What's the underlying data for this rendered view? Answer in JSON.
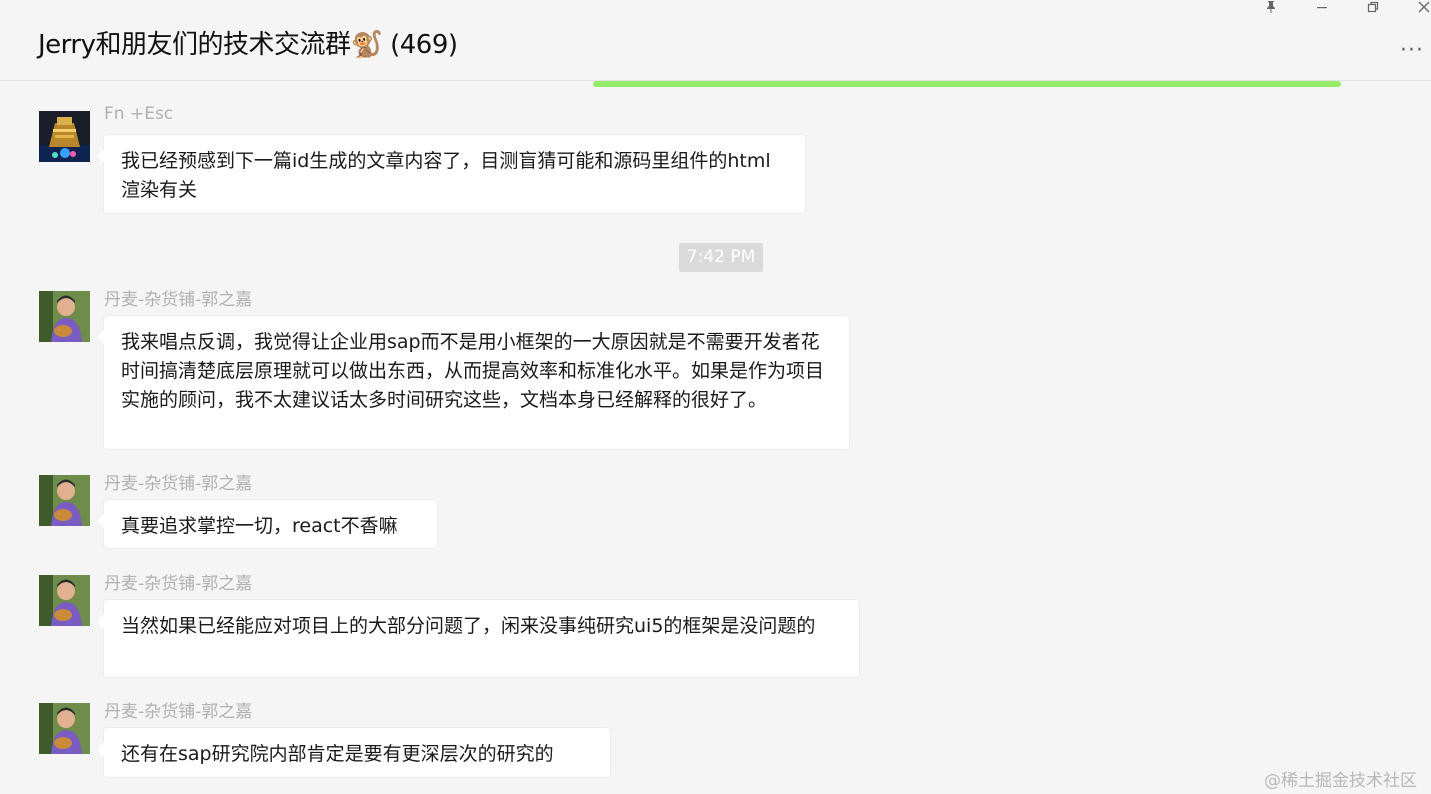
{
  "window": {
    "title": "Jerry和朋友们的技术交流群🐒 (469)",
    "pin_icon": "pin-icon",
    "minimize_icon": "minimize-icon",
    "restore_icon": "restore-icon",
    "close_icon": "close-icon",
    "more_label": "···"
  },
  "colors": {
    "background": "#f5f5f5",
    "bubble": "#ffffff",
    "accent_green": "#95ec69",
    "sender_gray": "#b0b0b0"
  },
  "loading_progress": 1.0,
  "timestamp": "7:42 PM",
  "messages": [
    {
      "sender": "Fn +Esc",
      "text": "我已经预感到下一篇id生成的文章内容了，目测盲猜可能和源码里组件的html渲染有关"
    },
    {
      "sender": "丹麦-杂货铺-郭之嘉",
      "text": "我来唱点反调，我觉得让企业用sap而不是用小框架的一大原因就是不需要开发者花时间搞清楚底层原理就可以做出东西，从而提高效率和标准化水平。如果是作为项目实施的顾问，我不太建议话太多时间研究这些，文档本身已经解释的很好了。"
    },
    {
      "sender": "丹麦-杂货铺-郭之嘉",
      "text": "真要追求掌控一切，react不香嘛"
    },
    {
      "sender": "丹麦-杂货铺-郭之嘉",
      "text": "当然如果已经能应对项目上的大部分问题了，闲来没事纯研究ui5的框架是没问题的"
    },
    {
      "sender": "丹麦-杂货铺-郭之嘉",
      "text": "还有在sap研究院内部肯定是要有更深层次的研究的"
    }
  ],
  "watermark": "@稀土掘金技术社区"
}
